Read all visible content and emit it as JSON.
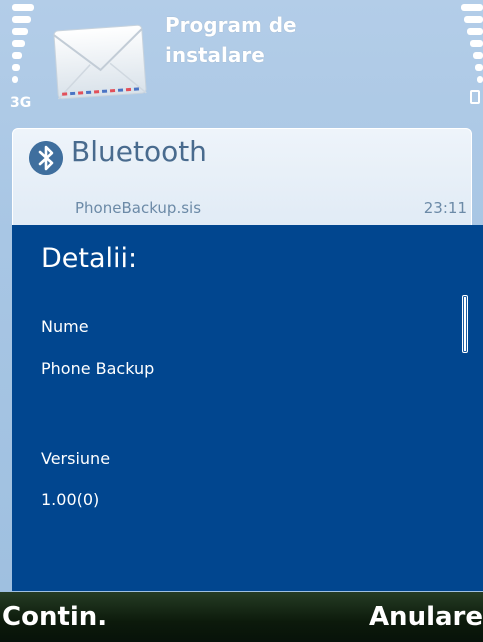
{
  "status": {
    "network_type": "3G"
  },
  "app": {
    "title_line1": "Program de",
    "title_line2": "instalare",
    "icon": "envelope-icon"
  },
  "message": {
    "icon": "bluetooth-icon",
    "sender": "Bluetooth",
    "file_name": "PhoneBackup.sis",
    "time": "23:11"
  },
  "dialog": {
    "title": "Detalii:",
    "fields": [
      {
        "label": "Nume",
        "value": "Phone Backup"
      },
      {
        "label": "Versiune",
        "value": "1.00(0)"
      }
    ]
  },
  "softkeys": {
    "left": "Contin.",
    "right": "Anulare"
  },
  "colors": {
    "dialog_bg": "#01468f",
    "header_bg": "#a8c6e4",
    "softkey_bg": "#0c1a0b",
    "text": "#ffffff"
  }
}
